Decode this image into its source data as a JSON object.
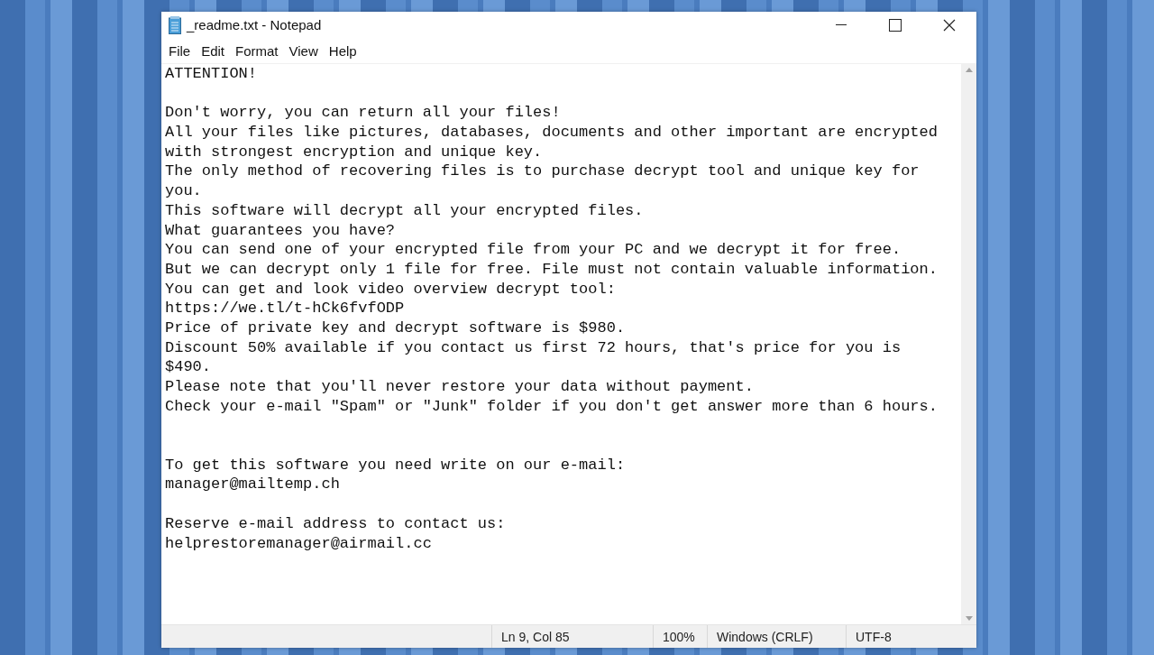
{
  "window": {
    "title": "_readme.txt - Notepad"
  },
  "menu": [
    "File",
    "Edit",
    "Format",
    "View",
    "Help"
  ],
  "document": {
    "lines": [
      {
        "kind": "text",
        "text": "ATTENTION!"
      },
      {
        "kind": "blank"
      },
      {
        "kind": "text",
        "text": "Don't worry, you can return all your files!"
      },
      {
        "kind": "text",
        "text": "All your files like pictures, databases, documents and other important are encrypted"
      },
      {
        "kind": "text",
        "text": "with strongest encryption and unique key."
      },
      {
        "kind": "text",
        "text": "The only method of recovering files is to purchase decrypt tool and unique key for"
      },
      {
        "kind": "text",
        "text": "you."
      },
      {
        "kind": "text",
        "text": "This software will decrypt all your encrypted files."
      },
      {
        "kind": "text",
        "text": "What guarantees you have?"
      },
      {
        "kind": "text",
        "text": "You can send one of your encrypted file from your PC and we decrypt it for free."
      },
      {
        "kind": "text",
        "text": "But we can decrypt only 1 file for free. File must not contain valuable information."
      },
      {
        "kind": "text",
        "text": "You can get and look video overview decrypt tool:"
      },
      {
        "kind": "text",
        "text": "https://we.tl/t-hCk6fvfODP"
      },
      {
        "kind": "text",
        "text": "Price of private key and decrypt software is $980."
      },
      {
        "kind": "text",
        "text": "Discount 50% available if you contact us first 72 hours, that's price for you is"
      },
      {
        "kind": "text",
        "text": "$490."
      },
      {
        "kind": "text",
        "text": "Please note that you'll never restore your data without payment."
      },
      {
        "kind": "text",
        "text": "Check your e-mail \"Spam\" or \"Junk\" folder if you don't get answer more than 6 hours."
      },
      {
        "kind": "blank"
      },
      {
        "kind": "blank"
      },
      {
        "kind": "text",
        "text": "To get this software you need write on our e-mail:"
      },
      {
        "kind": "text",
        "text": "manager@mailtemp.ch"
      },
      {
        "kind": "blank"
      },
      {
        "kind": "text",
        "text": "Reserve e-mail address to contact us:"
      },
      {
        "kind": "text",
        "text": "helprestoremanager@airmail.cc"
      }
    ]
  },
  "status_bar": {
    "position": "Ln 9, Col 85",
    "zoom": "100%",
    "line_endings": "Windows (CRLF)",
    "encoding": "UTF-8"
  }
}
